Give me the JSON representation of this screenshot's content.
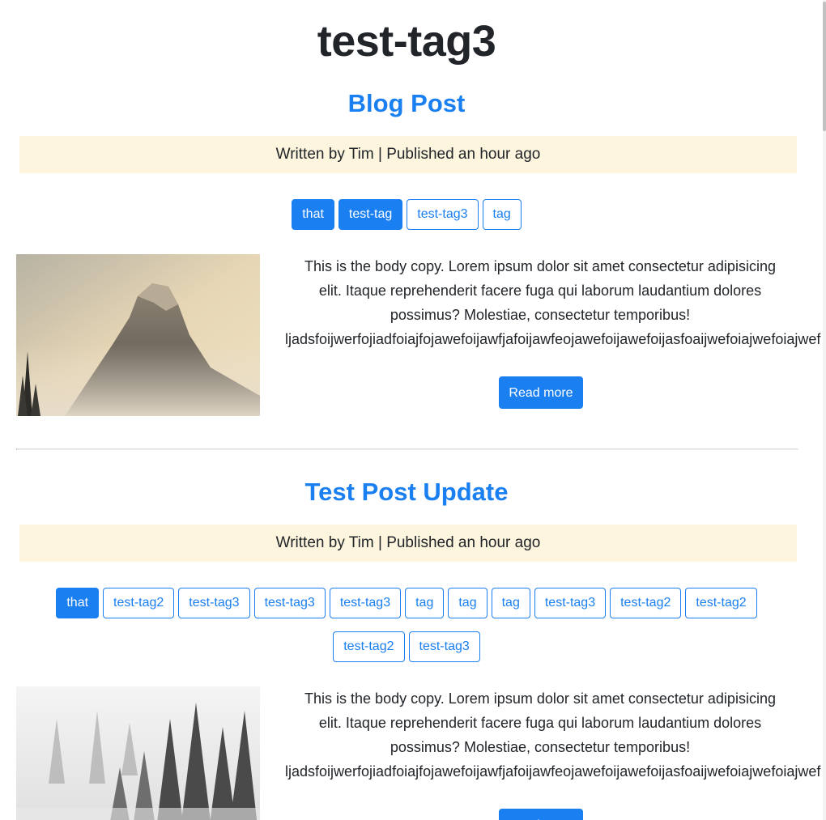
{
  "page": {
    "title": "test-tag3"
  },
  "posts": [
    {
      "title": "Blog Post",
      "meta": "Written by Tim | Published an hour ago",
      "tags": [
        {
          "label": "that",
          "active": true
        },
        {
          "label": "test-tag",
          "active": true
        },
        {
          "label": "test-tag3",
          "active": false
        },
        {
          "label": "tag",
          "active": false
        }
      ],
      "image": "mountain-image",
      "body_lines": [
        "This is the body copy. Lorem ipsum dolor sit amet consectetur adipisicing",
        "elit. Itaque reprehenderit facere fuga qui laborum laudantium dolores",
        "possimus? Molestiae, consectetur temporibus!",
        "ljadsfoijwerfojiadfoiajfojawefoijawfjafoijawfeojawefoijawefoijasfoaijwefoiajwefoiajwef"
      ],
      "read_more": "Read more"
    },
    {
      "title": "Test Post Update",
      "meta": "Written by Tim | Published an hour ago",
      "tags": [
        {
          "label": "that",
          "active": true
        },
        {
          "label": "test-tag2",
          "active": false
        },
        {
          "label": "test-tag3",
          "active": false
        },
        {
          "label": "test-tag3",
          "active": false
        },
        {
          "label": "test-tag3",
          "active": false
        },
        {
          "label": "tag",
          "active": false
        },
        {
          "label": "tag",
          "active": false
        },
        {
          "label": "tag",
          "active": false
        },
        {
          "label": "test-tag3",
          "active": false
        },
        {
          "label": "test-tag2",
          "active": false
        },
        {
          "label": "test-tag2",
          "active": false
        },
        {
          "label": "test-tag2",
          "active": false
        },
        {
          "label": "test-tag3",
          "active": false
        }
      ],
      "image": "forest-fog-image",
      "body_lines": [
        "This is the body copy. Lorem ipsum dolor sit amet consectetur adipisicing",
        "elit. Itaque reprehenderit facere fuga qui laborum laudantium dolores",
        "possimus? Molestiae, consectetur temporibus!",
        "ljadsfoijwerfojiadfoiajfojawefoijawfjafoijawfeojawefoijawefoijasfoaijwefoiajwefoiajwef"
      ],
      "read_more": "Read more"
    }
  ],
  "colors": {
    "primary": "#1a7ff0",
    "meta_bg": "#fdf5de",
    "text": "#212529"
  }
}
